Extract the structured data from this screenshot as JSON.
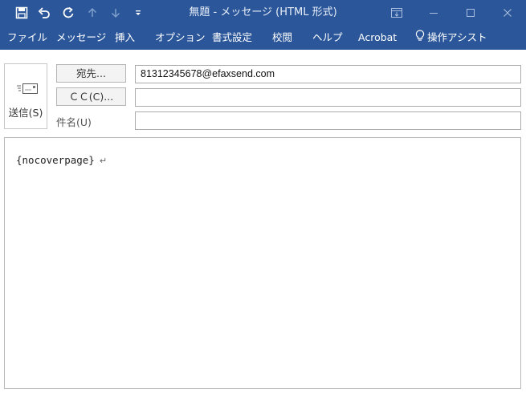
{
  "window": {
    "title": "無題  -  メッセージ (HTML 形式)"
  },
  "quick_access": {
    "icons": [
      "save-icon",
      "undo-icon",
      "redo-icon",
      "up-arrow-icon",
      "down-arrow-icon",
      "customize-icon"
    ]
  },
  "window_controls": {
    "icons": [
      "ribbon-display-icon",
      "minimize-icon",
      "maximize-icon",
      "close-icon"
    ]
  },
  "menu": {
    "items": [
      "ファイル",
      "メッセージ",
      "挿入",
      "オプション",
      "書式設定",
      "校閲",
      "ヘルプ",
      "Acrobat",
      "操作アシスト"
    ],
    "tell_me_icon": "lightbulb-icon"
  },
  "compose": {
    "send_label": "送信(S)",
    "to_button": "宛先...",
    "cc_button": "ＣＣ(C)...",
    "subject_label": "件名(U)",
    "to_value": "81312345678@efaxsend.com",
    "cc_value": "",
    "subject_value": ""
  },
  "body": {
    "text": "{nocoverpage}",
    "paragraph_mark": "↵"
  },
  "colors": {
    "titlebar": "#2b579a",
    "text_on_bar": "#ffffff"
  }
}
